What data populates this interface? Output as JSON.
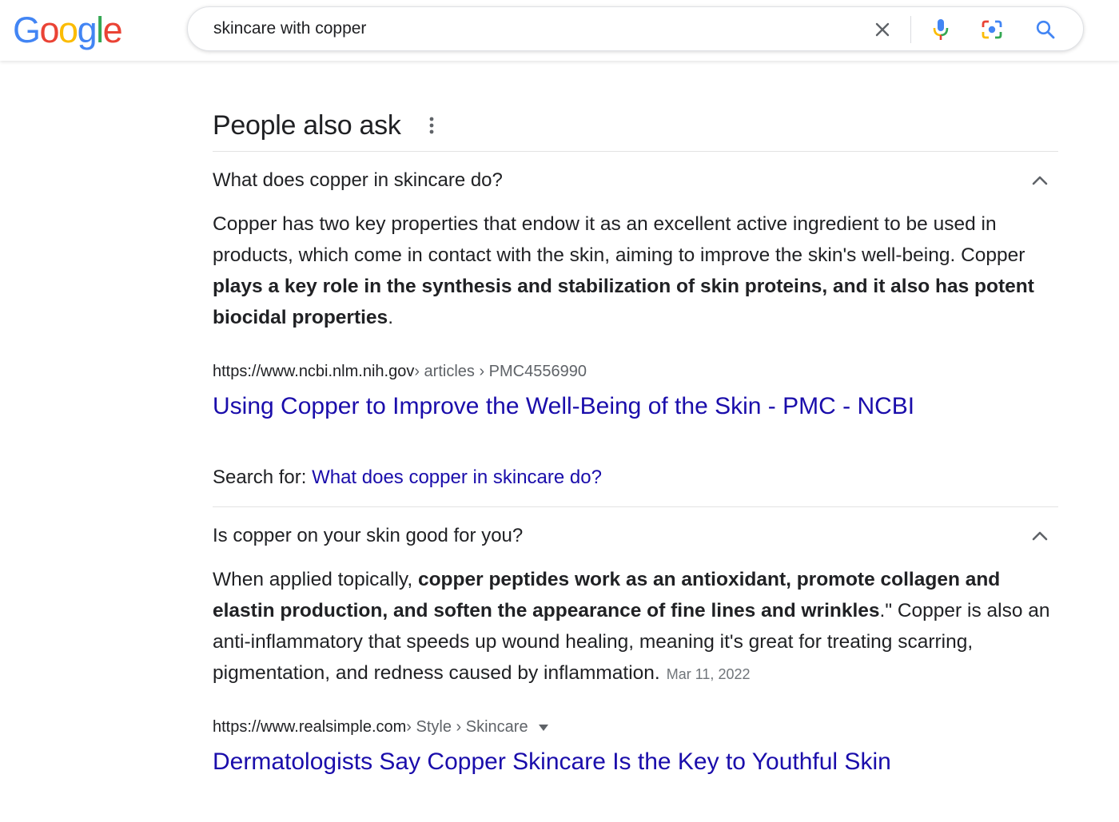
{
  "header": {
    "logo_text": "Google",
    "search": {
      "query": "skincare with copper",
      "clear_icon": "close-icon",
      "voice_icon": "microphone-icon",
      "lens_icon": "camera-lens-icon",
      "submit_icon": "search-icon"
    }
  },
  "paa": {
    "title": "People also ask",
    "items": [
      {
        "question": "What does copper in skincare do?",
        "answer_plain_1": "Copper has two key properties that endow it as an excellent active ingredient to be used in products, which come in contact with the skin, aiming to improve the skin's well-being. Copper ",
        "answer_bold": "plays a key role in the synthesis and stabilization of skin proteins, and it also has potent biocidal properties",
        "answer_plain_2": ".",
        "cite_domain": "https://www.ncbi.nlm.nih.gov",
        "cite_path": " › articles › PMC4556990",
        "link_title": "Using Copper to Improve the Well-Being of the Skin - PMC - NCBI",
        "search_for_label": "Search for: ",
        "search_for_query": "What does copper in skincare do?"
      },
      {
        "question": "Is copper on your skin good for you?",
        "answer_plain_1": "When applied topically, ",
        "answer_bold": "copper peptides work as an antioxidant, promote collagen and elastin production, and soften the appearance of fine lines and wrinkles",
        "answer_plain_2": ".\" Copper is also an anti-inflammatory that speeds up wound healing, meaning it's great for treating scarring, pigmentation, and redness caused by inflammation.",
        "date": "Mar 11, 2022",
        "cite_domain": "https://www.realsimple.com",
        "cite_path": " › Style › Skincare",
        "link_title": "Dermatologists Say Copper Skincare Is the Key to Youthful Skin"
      }
    ]
  },
  "colors": {
    "link": "#1a0dab",
    "text": "#202124",
    "muted": "#5f6368",
    "google_blue": "#4285F4",
    "google_red": "#EA4335",
    "google_yellow": "#FBBC05",
    "google_green": "#34A853"
  }
}
